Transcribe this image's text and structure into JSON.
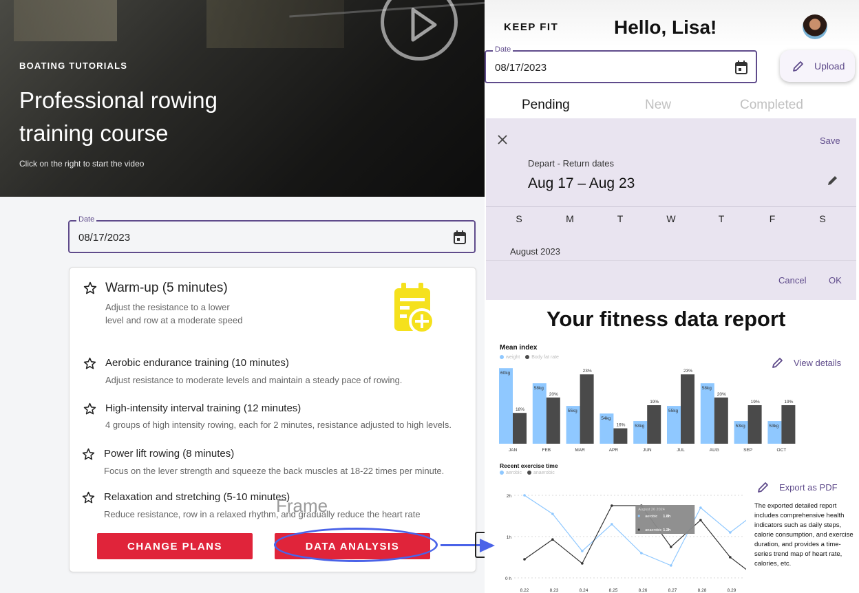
{
  "hero": {
    "eyebrow": "BOATING TUTORIALS",
    "title": "Professional rowing training course",
    "subtitle": "Click on the right to start the video"
  },
  "left_date": {
    "label": "Date",
    "value": "08/17/2023"
  },
  "plan": {
    "items": [
      {
        "title": "Warm-up (5 minutes)",
        "desc": "Adjust the resistance to a lower level and row at a moderate speed"
      },
      {
        "title": "Aerobic endurance training (10 minutes)",
        "desc": "Adjust resistance to moderate levels and maintain a steady pace of rowing."
      },
      {
        "title": "High-intensity interval training (12 minutes)",
        "desc": "4 groups of high intensity rowing, each for 2 minutes, resistance adjusted to high levels."
      },
      {
        "title": "Power lift rowing (8 minutes)",
        "desc": "Focus on the lever strength and squeeze the back muscles at 18-22 times per minute."
      },
      {
        "title": "Relaxation and stretching (5-10 minutes)",
        "desc": "Reduce resistance, row in a relaxed rhythm, and gradually reduce the heart rate"
      }
    ],
    "frame_label": "Frame",
    "change_label": "CHANGE PLANS",
    "analysis_label": "DATA ANALYSIS"
  },
  "header": {
    "brand": "KEEP FIT",
    "greeting": "Hello, Lisa!",
    "upload_label": "Upload"
  },
  "right_date": {
    "label": "Date",
    "value": "08/17/2023"
  },
  "tabs": [
    "Pending",
    "New",
    "Completed"
  ],
  "picker": {
    "save": "Save",
    "range_label": "Depart - Return dates",
    "range_value": "Aug 17 – Aug 23",
    "weekdays": [
      "S",
      "M",
      "T",
      "W",
      "T",
      "F",
      "S"
    ],
    "month": "August 2023",
    "cancel": "Cancel",
    "ok": "OK"
  },
  "report": {
    "title": "Your fitness data report",
    "view_details": "View details",
    "export": "Export as PDF",
    "export_desc": "The exported detailed report includes comprehensive health indicators such as daily steps, calorie consumption, and exercise duration, and provides a time-series trend map of heart rate, calories, etc."
  },
  "colors": {
    "accent": "#5f4b8b",
    "red": "#e0243a",
    "blue_series": "#8fc8ff",
    "dark_series": "#4a4a4a"
  },
  "chart_data": [
    {
      "type": "bar",
      "title": "Mean index",
      "categories": [
        "JAN",
        "FEB",
        "MAR",
        "APR",
        "JUN",
        "JUL",
        "AUG",
        "SEP",
        "OCT"
      ],
      "series": [
        {
          "name": "weight",
          "values": [
            60,
            58,
            55,
            54,
            53,
            55,
            58,
            53,
            53
          ],
          "labels": [
            "60kg",
            "58kg",
            "55kg",
            "54kg",
            "53kg",
            "55kg",
            "58kg",
            "53kg",
            "53kg"
          ],
          "color": "#8fc8ff"
        },
        {
          "name": "Body fat rate",
          "values": [
            18,
            20,
            23,
            16,
            19,
            23,
            20,
            19,
            19
          ],
          "labels": [
            "18%",
            "20%",
            "23%",
            "16%",
            "19%",
            "23%",
            "20%",
            "19%",
            "19%"
          ],
          "color": "#4a4a4a"
        }
      ]
    },
    {
      "type": "line",
      "title": "Recent exercise time",
      "x": [
        "8.22",
        "8.23",
        "8.24",
        "8.25",
        "8.26",
        "8.27",
        "8.28",
        "8.29"
      ],
      "y_ticks": [
        "0 h",
        "1h",
        "2h"
      ],
      "ylim": [
        0,
        2
      ],
      "series": [
        {
          "name": "aerobic",
          "color": "#8fc8ff",
          "points": [
            [
              0,
              2.0
            ],
            [
              0.95,
              1.55
            ],
            [
              1.95,
              0.65
            ],
            [
              2.95,
              1.3
            ],
            [
              3.95,
              0.6
            ],
            [
              4.95,
              0.3
            ],
            [
              5.95,
              1.7
            ],
            [
              6.95,
              1.1
            ],
            [
              7.5,
              1.4
            ]
          ]
        },
        {
          "name": "anaerobic",
          "color": "#333333",
          "points": [
            [
              0,
              0.45
            ],
            [
              0.95,
              0.93
            ],
            [
              1.95,
              0.35
            ],
            [
              2.95,
              1.75
            ],
            [
              3.95,
              1.75
            ],
            [
              4.95,
              0.75
            ],
            [
              5.95,
              1.4
            ],
            [
              6.95,
              0.5
            ],
            [
              7.5,
              0.2
            ]
          ]
        }
      ],
      "tooltip": {
        "date": "August 26 2024",
        "rows": [
          {
            "name": "aerobic",
            "value": "1.8h"
          },
          {
            "name": "anaerobic",
            "value": "1.2h"
          }
        ]
      }
    }
  ]
}
